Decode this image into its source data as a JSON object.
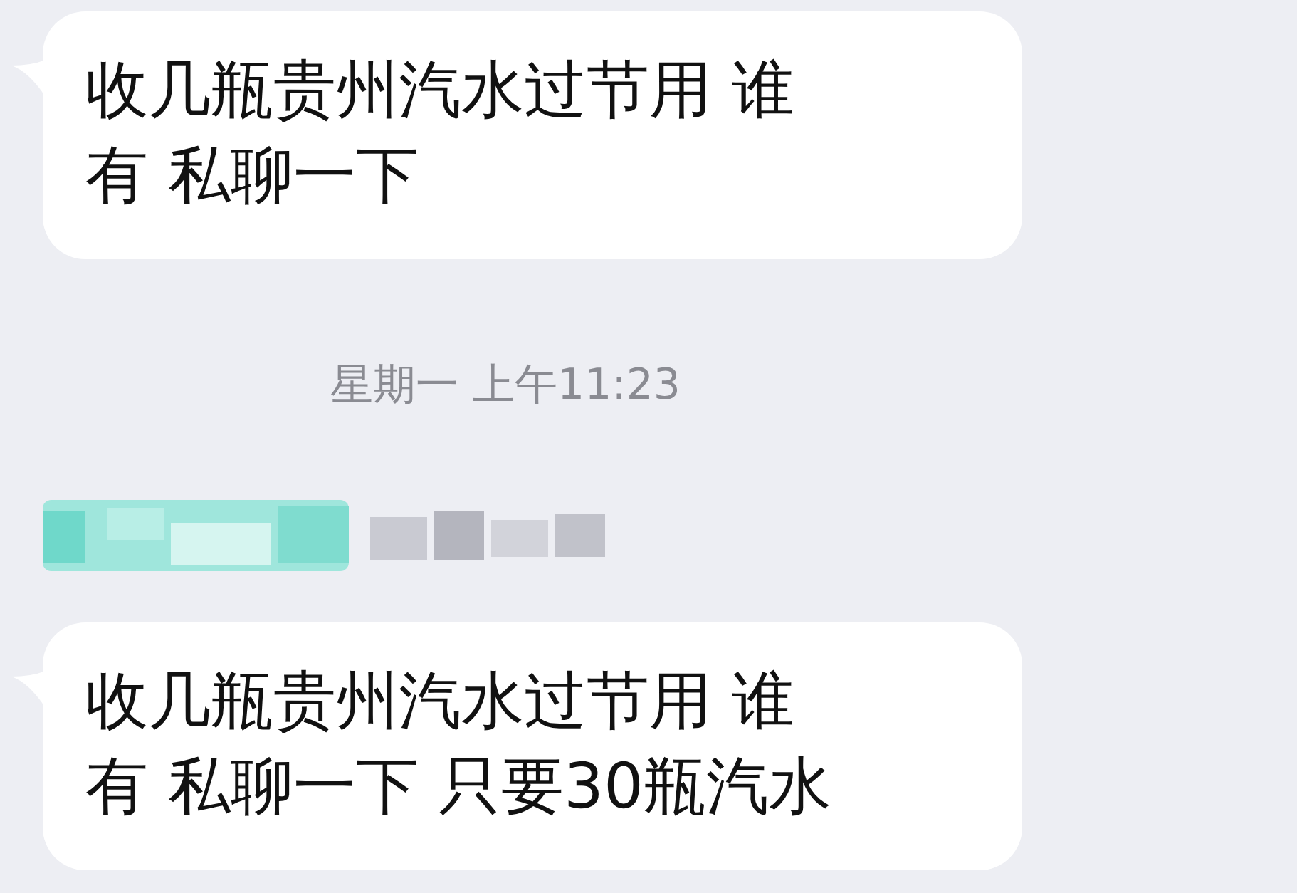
{
  "chat": [
    {
      "kind": "message",
      "text": "收几瓶贵州汽水过节用 谁有 私聊一下"
    },
    {
      "kind": "timestamp",
      "text": "星期一 上午11:23"
    },
    {
      "kind": "sender"
    },
    {
      "kind": "message",
      "text": "收几瓶贵州汽水过节用 谁有 私聊一下 只要30瓶汽水"
    }
  ]
}
